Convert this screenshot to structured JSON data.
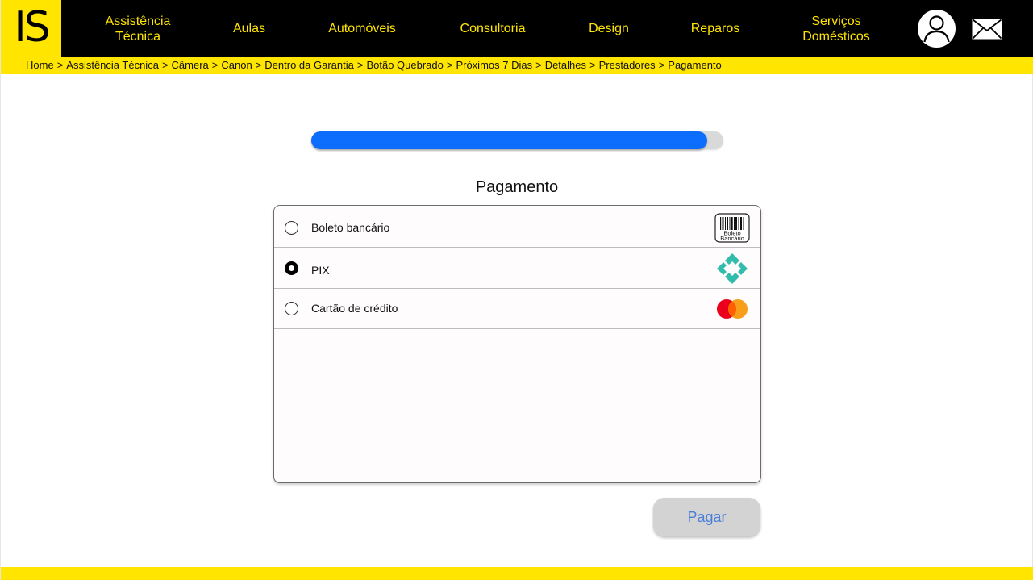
{
  "logo": {
    "text": "IS"
  },
  "nav": [
    {
      "label": "Assistência\nTécnica"
    },
    {
      "label": "Aulas"
    },
    {
      "label": "Automóveis"
    },
    {
      "label": "Consultoria"
    },
    {
      "label": "Design"
    },
    {
      "label": "Reparos"
    },
    {
      "label": "Serviços\nDomésticos"
    }
  ],
  "header_icons": {
    "user": "user-icon",
    "mail": "mail-icon"
  },
  "breadcrumb": {
    "separator": ">",
    "items": [
      "Home",
      "Assistência Técnica",
      "Câmera",
      "Canon",
      "Dentro da Garantia",
      "Botão Quebrado",
      "Próximos 7 Dias",
      "Detalhes",
      "Prestadores",
      "Pagamento"
    ]
  },
  "progress": {
    "value": 0.96
  },
  "payment": {
    "title": "Pagamento",
    "options": [
      {
        "label": "Boleto bancário",
        "selected": false,
        "icon": "barcode-icon",
        "icon_text_1": "Boleto",
        "icon_text_2": "Bancário"
      },
      {
        "label": "PIX",
        "selected": true,
        "icon": "pix-icon"
      },
      {
        "label": "Cartão de crédito",
        "selected": false,
        "icon": "mastercard-icon"
      }
    ],
    "button_label": "Pagar"
  },
  "colors": {
    "brand_yellow": "#FFE500",
    "header_black": "#000000",
    "progress_blue": "#0D6EFD",
    "button_text": "#4a7fd8"
  }
}
